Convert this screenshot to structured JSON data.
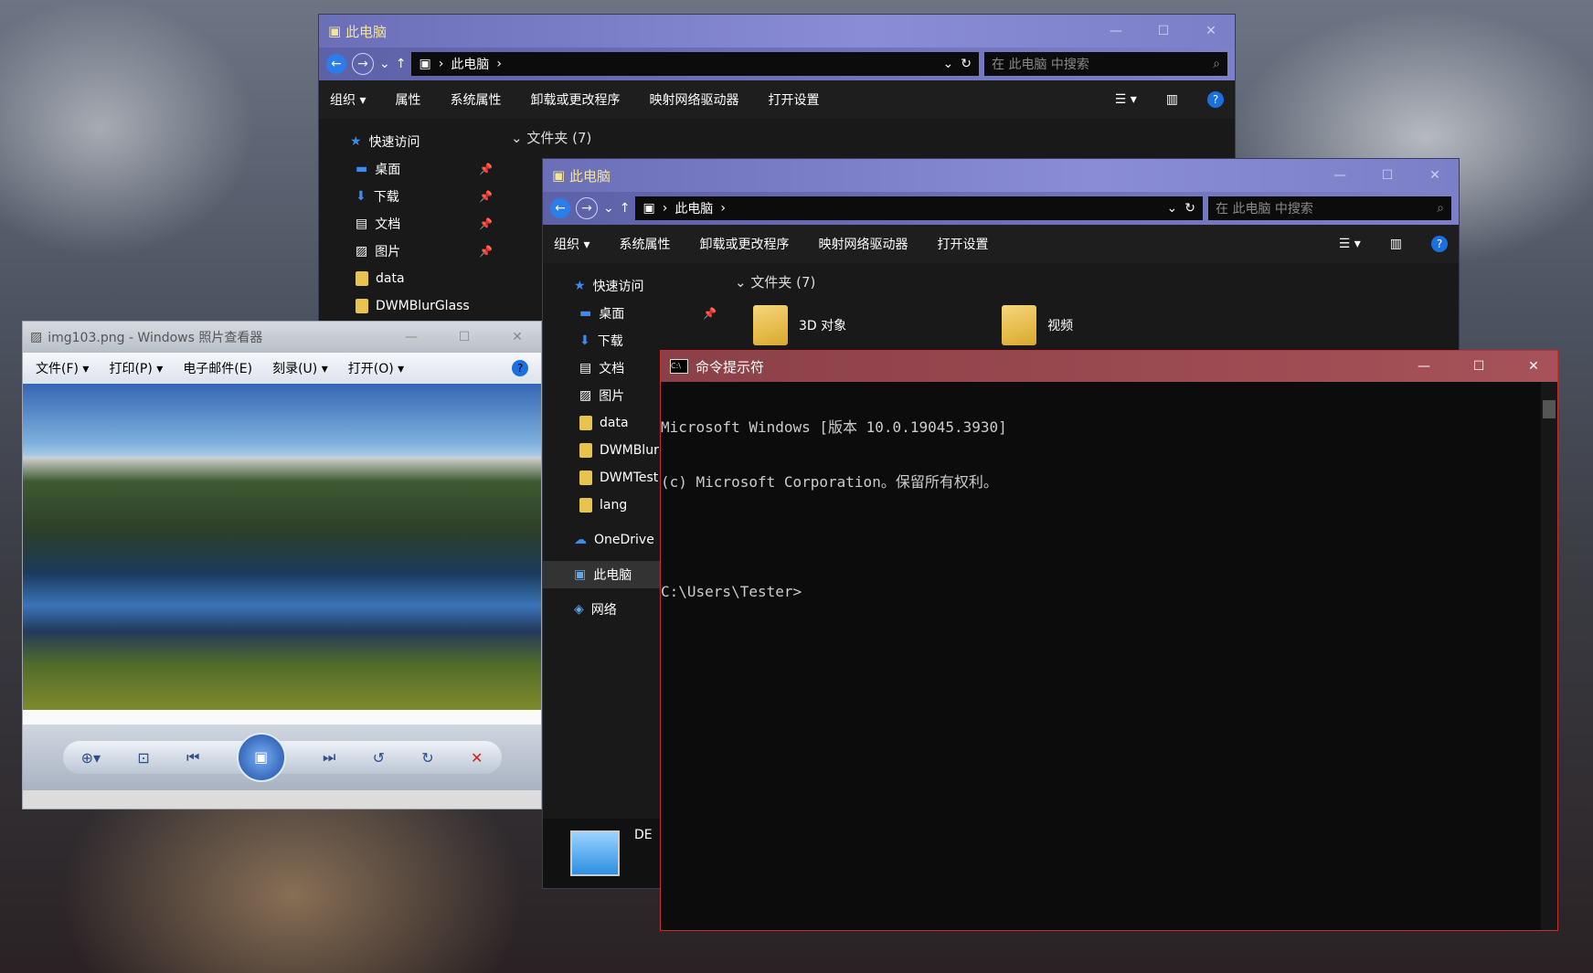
{
  "explorer_back": {
    "title": "此电脑",
    "address": "此电脑",
    "search_placeholder": "在 此电脑 中搜索",
    "ribbon": [
      "组织 ▾",
      "属性",
      "系统属性",
      "卸载或更改程序",
      "映射网络驱动器",
      "打开设置"
    ],
    "group": "文件夹 (7)",
    "sidebar": [
      "快速访问",
      "桌面",
      "下载",
      "文档",
      "图片",
      "data",
      "DWMBlurGlass"
    ]
  },
  "explorer_front": {
    "title": "此电脑",
    "address": "此电脑",
    "search_placeholder": "在 此电脑 中搜索",
    "ribbon": [
      "组织 ▾",
      "系统属性",
      "卸载或更改程序",
      "映射网络驱动器",
      "打开设置"
    ],
    "group": "文件夹 (7)",
    "sidebar": [
      "快速访问",
      "桌面",
      "下载",
      "文档",
      "图片",
      "data",
      "DWMBlur",
      "DWMTest",
      "lang",
      "OneDrive",
      "此电脑",
      "网络"
    ],
    "files": [
      "3D 对象",
      "视频"
    ],
    "bottom_label": "DE"
  },
  "photo_viewer": {
    "title": "img103.png - Windows 照片查看器",
    "menu": [
      "文件(F) ▾",
      "打印(P) ▾",
      "电子邮件(E)",
      "刻录(U) ▾",
      "打开(O) ▾"
    ]
  },
  "cmd": {
    "title": "命令提示符",
    "line1": "Microsoft Windows [版本 10.0.19045.3930]",
    "line2": "(c) Microsoft Corporation。保留所有权利。",
    "line3": "",
    "line4": "C:\\Users\\Tester>"
  },
  "window_controls": {
    "min": "—",
    "max": "☐",
    "close": "✕"
  }
}
